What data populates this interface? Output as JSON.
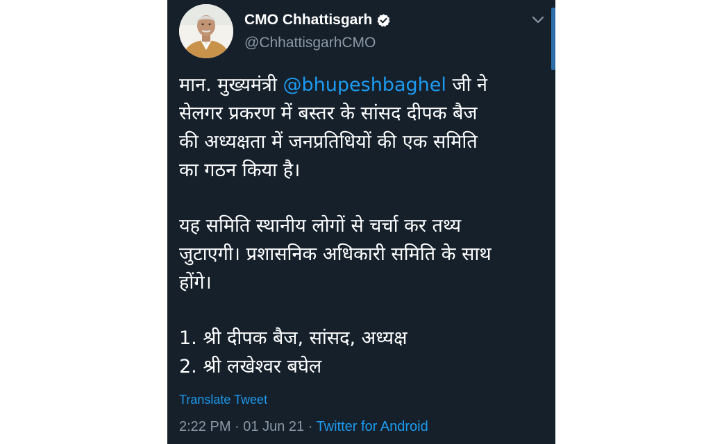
{
  "tweet": {
    "author": {
      "display_name": "CMO Chhattisgarh",
      "handle": "@ChhattisgarhCMO",
      "verified_icon": "verified-badge-icon",
      "avatar_icon": "profile-photo"
    },
    "menu_icon": "chevron-down-icon",
    "body": {
      "p1_prefix": "मान. मुख्यमंत्री ",
      "p1_mention": "@bhupeshbaghel",
      "p1_line1_suffix": " जी ने",
      "p1_line2": "सेलगर प्रकरण में बस्तर के सांसद दीपक बैज",
      "p1_line3": "की अध्यक्षता में जनप्रतिधियों की एक समिति",
      "p1_line4": "का गठन किया है।",
      "p2_line1": "यह समिति स्थानीय लोगों से चर्चा कर तथ्य",
      "p2_line2": "जुटाएगी। प्रशासनिक अधिकारी समिति के साथ",
      "p2_line3": "होंगे।",
      "list": [
        "1. श्री दीपक बैज, सांसद, अध्यक्ष",
        "2. श्री लखेश्वर बघेल"
      ]
    },
    "translate_label": "Translate Tweet",
    "meta": {
      "time": "2:22 PM",
      "separator": " · ",
      "date": "01 Jun 21",
      "source": "Twitter for Android"
    },
    "colors": {
      "background": "#15202b",
      "link": "#1d9bf0",
      "secondary_text": "#8b98a5"
    }
  }
}
